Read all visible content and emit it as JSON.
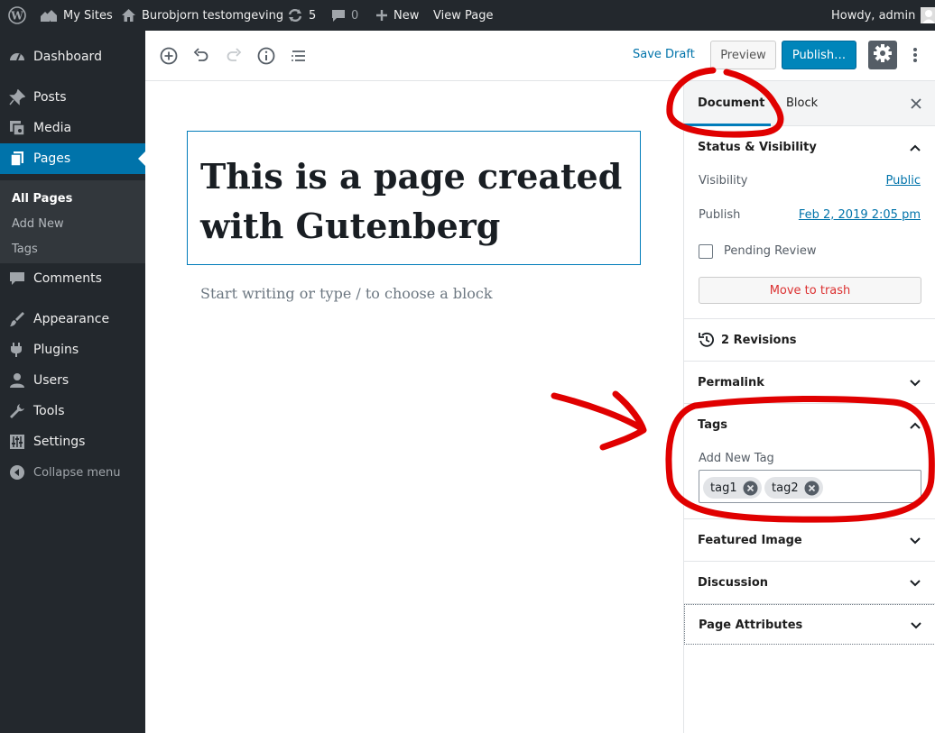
{
  "adminbar": {
    "my_sites": "My Sites",
    "site_name": "Burobjorn testomgeving",
    "updates_count": "5",
    "comments_count": "0",
    "new_label": "New",
    "view_page": "View Page",
    "howdy": "Howdy, admin"
  },
  "sidebar": {
    "items": [
      {
        "label": "Dashboard",
        "icon": "dashboard-icon"
      },
      {
        "label": "Posts",
        "icon": "pushpin-icon"
      },
      {
        "label": "Media",
        "icon": "media-icon"
      },
      {
        "label": "Pages",
        "icon": "pages-icon"
      },
      {
        "label": "Comments",
        "icon": "comment-icon"
      },
      {
        "label": "Appearance",
        "icon": "paintbrush-icon"
      },
      {
        "label": "Plugins",
        "icon": "plugin-icon"
      },
      {
        "label": "Users",
        "icon": "user-icon"
      },
      {
        "label": "Tools",
        "icon": "wrench-icon"
      },
      {
        "label": "Settings",
        "icon": "settings-sliders-icon"
      },
      {
        "label": "Collapse menu",
        "icon": "collapse-icon"
      }
    ],
    "submenu": [
      "All Pages",
      "Add New",
      "Tags"
    ]
  },
  "header": {
    "save_draft": "Save Draft",
    "preview": "Preview",
    "publish": "Publish…"
  },
  "editor": {
    "title": "This is a page created with Gutenberg",
    "placeholder": "Start writing or type / to choose a block"
  },
  "panel": {
    "tab_document": "Document",
    "tab_block": "Block",
    "status_title": "Status & Visibility",
    "visibility_label": "Visibility",
    "visibility_value": "Public",
    "publish_label": "Publish",
    "publish_value": "Feb 2, 2019 2:05 pm",
    "pending_review": "Pending Review",
    "move_to_trash": "Move to trash",
    "revisions": "2 Revisions",
    "permalink": "Permalink",
    "tags_title": "Tags",
    "add_new_tag": "Add New Tag",
    "tags": [
      "tag1",
      "tag2"
    ],
    "featured_image": "Featured Image",
    "discussion": "Discussion",
    "page_attributes": "Page Attributes"
  },
  "colors": {
    "admin_dark": "#23282d",
    "accent": "#0073aa",
    "publish": "#0085ba",
    "danger": "#dc3232",
    "annotation": "#e00000"
  }
}
